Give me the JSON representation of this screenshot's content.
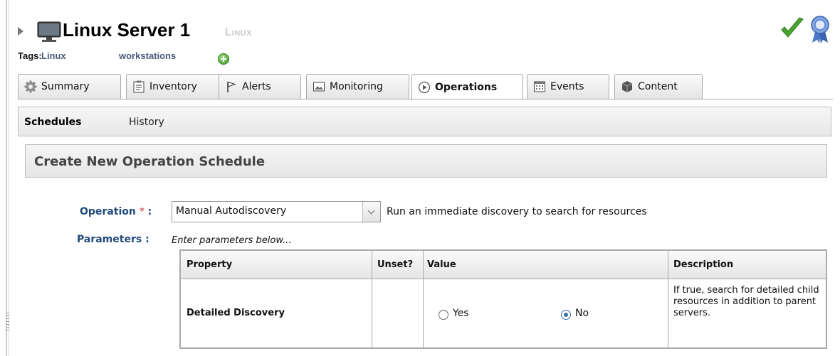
{
  "resource": {
    "title": "Linux Server 1",
    "type_label": "Linux"
  },
  "tags": {
    "label": "Tags:",
    "items": [
      "Linux",
      "workstations"
    ]
  },
  "tabs": [
    {
      "label": "Summary",
      "icon": "gear-icon"
    },
    {
      "label": "Inventory",
      "icon": "clipboard-icon"
    },
    {
      "label": "Alerts",
      "icon": "flag-icon"
    },
    {
      "label": "Monitoring",
      "icon": "picture-icon"
    },
    {
      "label": "Operations",
      "icon": "play-icon",
      "active": true
    },
    {
      "label": "Events",
      "icon": "calendar-icon"
    },
    {
      "label": "Content",
      "icon": "package-icon"
    }
  ],
  "subtabs": [
    {
      "label": "Schedules",
      "active": true
    },
    {
      "label": "History"
    }
  ],
  "form": {
    "header": "Create New Operation Schedule",
    "operation_label": "Operation",
    "required_mark": "*",
    "colon": ":",
    "operation_value": "Manual Autodiscovery",
    "operation_description": "Run an immediate discovery to search for resources",
    "parameters_label": "Parameters",
    "parameters_hint": "Enter parameters below..."
  },
  "params_table": {
    "headers": {
      "property": "Property",
      "unset": "Unset?",
      "value": "Value",
      "description": "Description"
    },
    "rows": [
      {
        "property": "Detailed Discovery",
        "options": [
          "Yes",
          "No"
        ],
        "selected": "No",
        "description": "If true, search for detailed child resources in addition to parent servers."
      }
    ]
  },
  "colors": {
    "link": "#1f4a7a",
    "required": "#c03030",
    "availability_up": "#3c9a2a"
  }
}
